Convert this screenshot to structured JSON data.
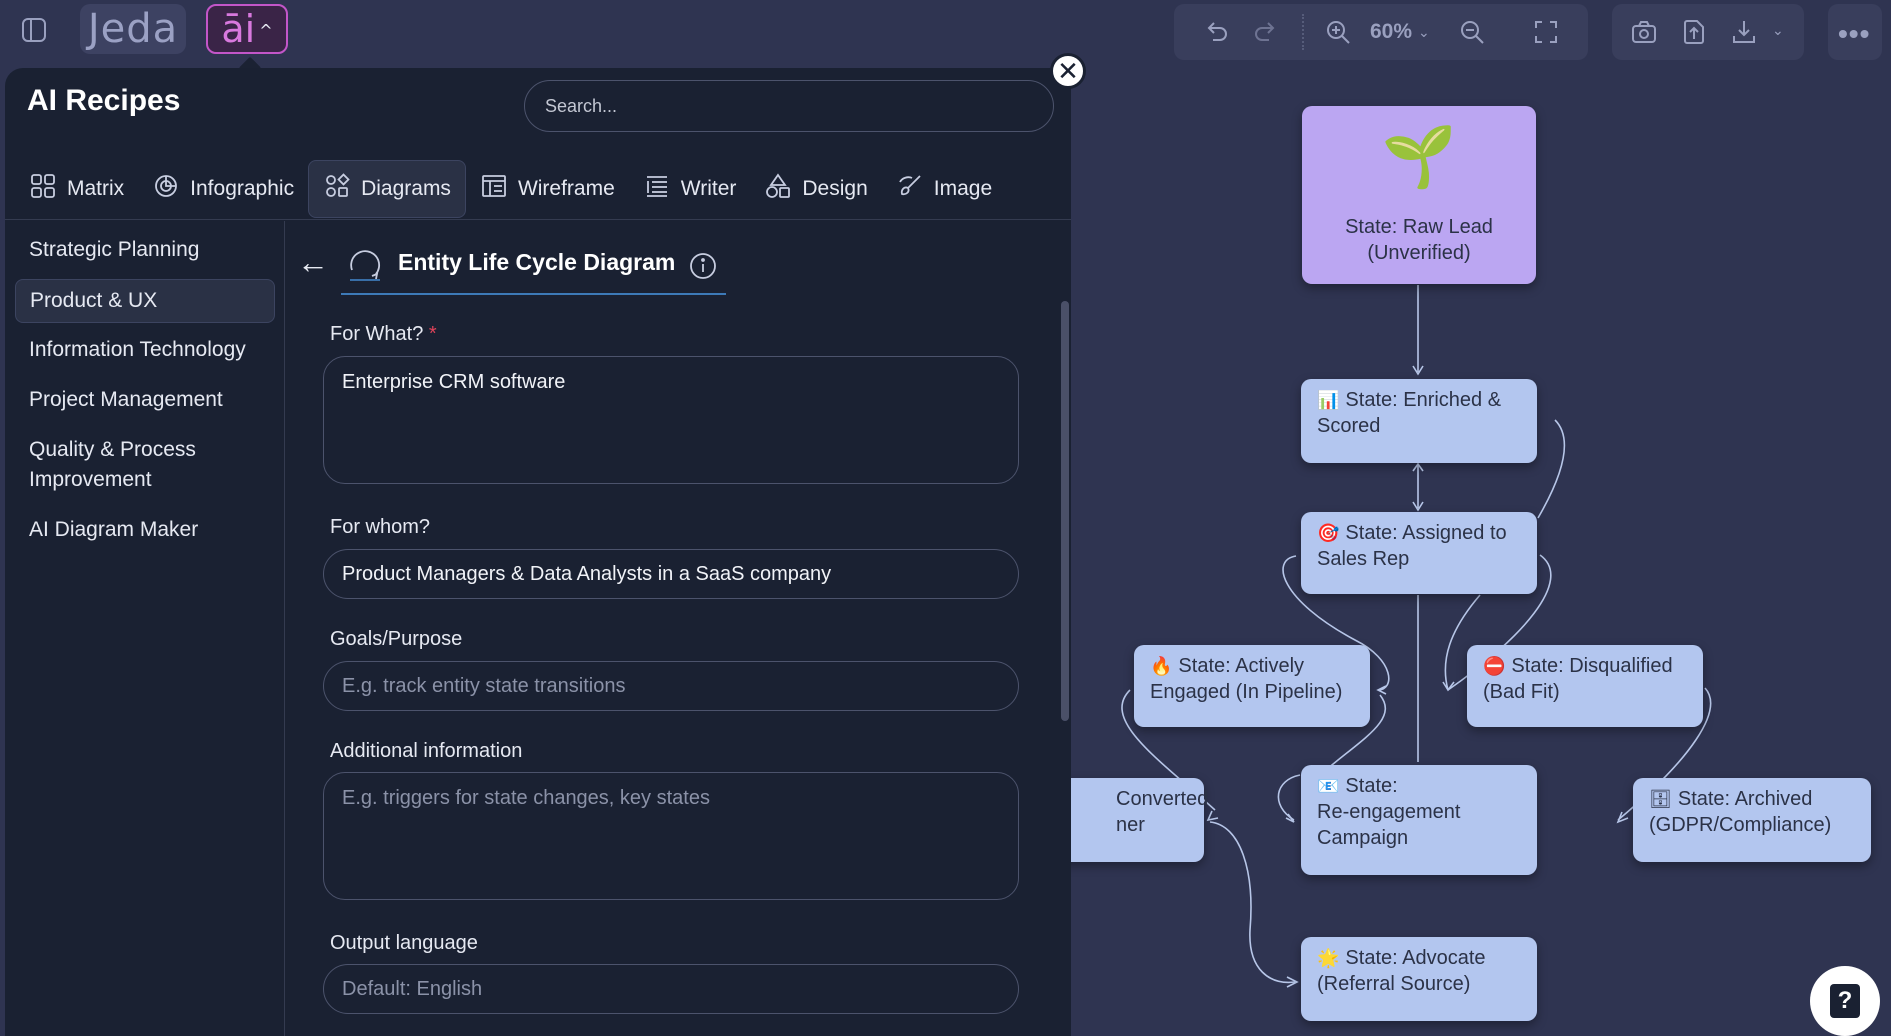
{
  "brand": {
    "logo": "Jeda",
    "ai_badge": "āi"
  },
  "toolbar": {
    "zoom": "60%"
  },
  "panel": {
    "title": "AI Recipes",
    "search_placeholder": "Search...",
    "tabs": [
      {
        "label": "Matrix",
        "icon": "matrix-icon"
      },
      {
        "label": "Infographic",
        "icon": "pie-chart-icon"
      },
      {
        "label": "Diagrams",
        "icon": "shapes-icon"
      },
      {
        "label": "Wireframe",
        "icon": "wireframe-icon"
      },
      {
        "label": "Writer",
        "icon": "writer-icon"
      },
      {
        "label": "Design",
        "icon": "design-icon"
      },
      {
        "label": "Image",
        "icon": "brush-icon"
      }
    ],
    "active_tab": "Diagrams",
    "categories": [
      "Strategic Planning",
      "Product & UX",
      "Information Technology",
      "Project Management",
      "Quality & Process Improvement",
      "AI Diagram Maker"
    ],
    "active_category": "Product & UX",
    "recipe": {
      "back": "←",
      "title": "Entity Life Cycle Diagram"
    },
    "form": {
      "for_what": {
        "label": "For What?",
        "required_mark": "*",
        "value": "Enterprise CRM software"
      },
      "for_whom": {
        "label": "For whom?",
        "value": "Product Managers & Data Analysts in a SaaS company"
      },
      "goals": {
        "label": "Goals/Purpose",
        "placeholder": "E.g. track entity state transitions"
      },
      "additional": {
        "label": "Additional information",
        "placeholder": "E.g. triggers for state changes, key states"
      },
      "language": {
        "label": "Output language",
        "placeholder": "Default: English"
      }
    }
  },
  "diagram": {
    "nodes": [
      {
        "id": "raw",
        "emoji": "🌱",
        "line1": "State: Raw Lead",
        "line2": "(Unverified)"
      },
      {
        "id": "enriched",
        "emoji": "📊",
        "line1": "State: Enriched &",
        "line2": "Scored"
      },
      {
        "id": "assigned",
        "emoji": "🎯",
        "line1": "State: Assigned to",
        "line2": "Sales Rep"
      },
      {
        "id": "engaged",
        "emoji": "🔥",
        "line1": "State: Actively",
        "line2": "Engaged (In Pipeline)"
      },
      {
        "id": "disqualified",
        "emoji": "⛔",
        "line1": "State: Disqualified",
        "line2": "(Bad Fit)"
      },
      {
        "id": "converted",
        "emoji": "",
        "line1": "Converted",
        "line2": "ner"
      },
      {
        "id": "reengage",
        "emoji": "📧",
        "line1": "State:",
        "line2": "Re-engagement",
        "line3": "Campaign"
      },
      {
        "id": "archived",
        "emoji": "🗄",
        "line1": "State: Archived",
        "line2": "(GDPR/Compliance)"
      },
      {
        "id": "advocate",
        "emoji": "🌟",
        "line1": "State: Advocate",
        "line2": "(Referral Source)"
      }
    ]
  }
}
